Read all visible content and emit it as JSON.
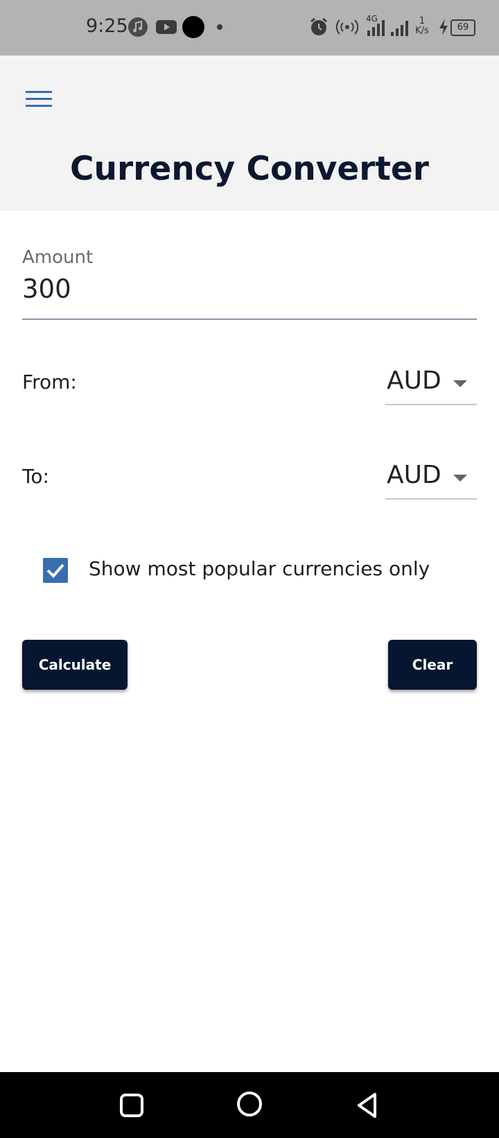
{
  "status_bar": {
    "time": "9:25",
    "left_icons": [
      "music-icon",
      "youtube-icon",
      "camera-dot-icon",
      "dot-icon"
    ],
    "right_icons": [
      "alarm-icon",
      "hotspot-icon",
      "signal-4g-icon",
      "signal-icon",
      "network-speed-icon",
      "charging-icon",
      "battery-icon"
    ],
    "network_type": "4G",
    "speed_value": "1",
    "speed_unit": "K/s",
    "battery": "69"
  },
  "header": {
    "menu_icon": "hamburger-menu-icon",
    "title": "Currency Converter",
    "background": "#f3f3f3",
    "title_color": "#0b1830"
  },
  "form": {
    "amount_label": "Amount",
    "amount_value": "300",
    "from_label": "From:",
    "from_value": "AUD",
    "to_label": "To:",
    "to_value": "AUD",
    "popular_only_label": "Show most popular currencies only",
    "popular_only_checked": true
  },
  "buttons": {
    "calculate_label": "Calculate",
    "clear_label": "Clear",
    "color": "#071630"
  },
  "accent_color": "#3a6db0",
  "nav_bar": {
    "icons": [
      "recent-apps-icon",
      "home-icon",
      "back-icon"
    ]
  }
}
